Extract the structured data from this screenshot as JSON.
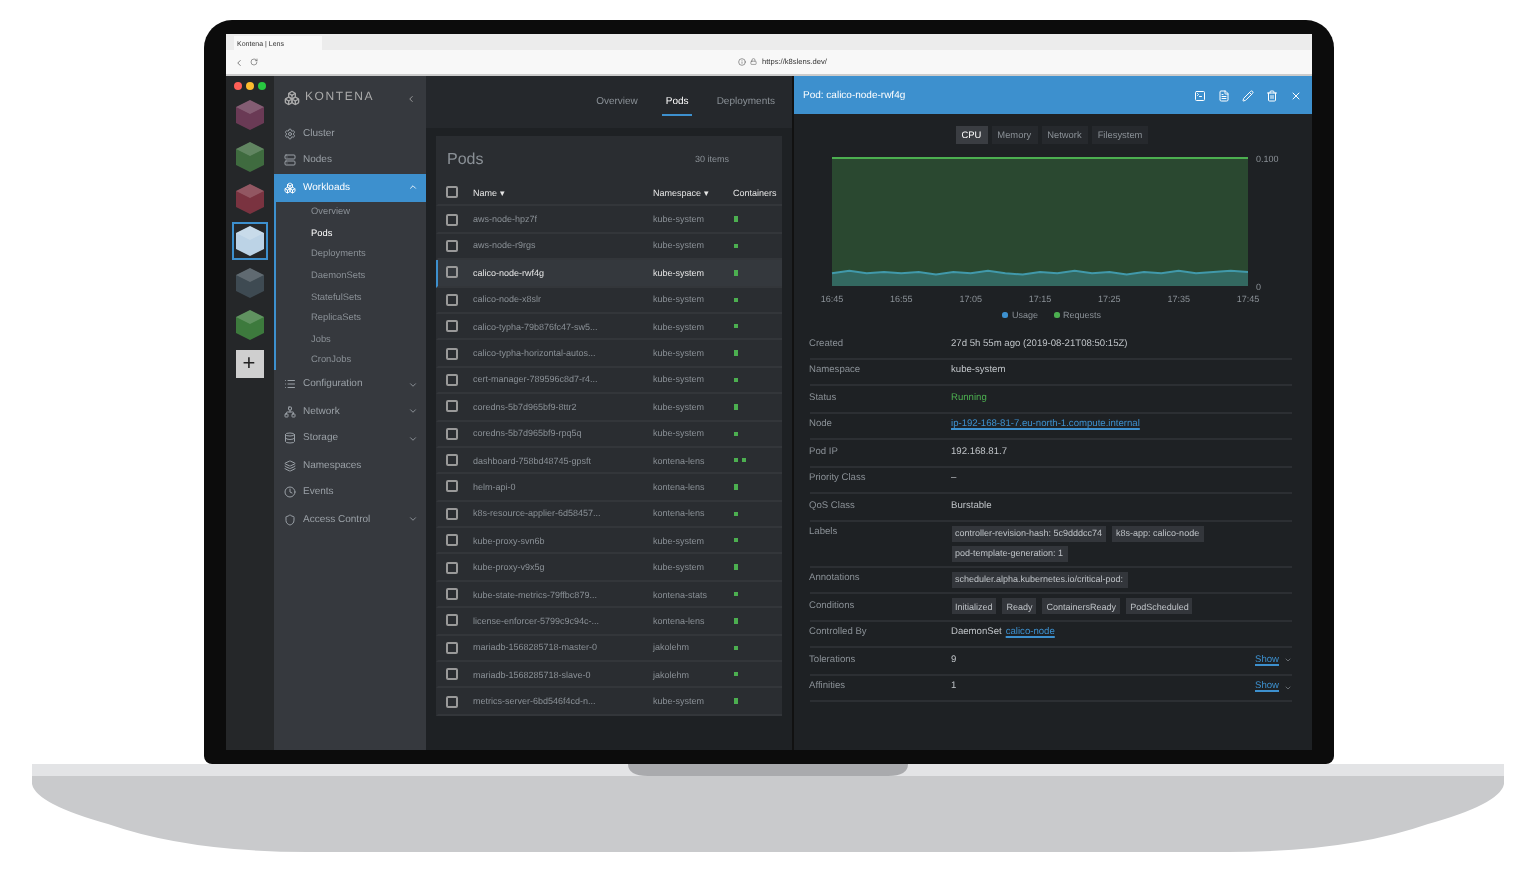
{
  "browser": {
    "tab_title": "Kontena | Lens",
    "address": "https://k8slens.dev/"
  },
  "hotbar": {
    "clusters": [
      {
        "color": "#6a3a55",
        "selected": false
      },
      {
        "color": "#3f6b3f",
        "selected": false
      },
      {
        "color": "#7a3340",
        "selected": false
      },
      {
        "color": "#bcd3e6",
        "selected": true
      },
      {
        "color": "#3e4a52",
        "selected": false
      },
      {
        "color": "#3d7a3d",
        "selected": false
      }
    ],
    "add_label": "+"
  },
  "sidebar": {
    "logo": "KONTENA",
    "items": [
      {
        "label": "Cluster",
        "selected": false
      },
      {
        "label": "Nodes",
        "selected": false
      },
      {
        "label": "Workloads",
        "selected": true,
        "expanded": true,
        "children": [
          {
            "label": "Overview",
            "selected": false
          },
          {
            "label": "Pods",
            "selected": true
          },
          {
            "label": "Deployments",
            "selected": false
          },
          {
            "label": "DaemonSets",
            "selected": false
          },
          {
            "label": "StatefulSets",
            "selected": false
          },
          {
            "label": "ReplicaSets",
            "selected": false
          },
          {
            "label": "Jobs",
            "selected": false
          },
          {
            "label": "CronJobs",
            "selected": false
          }
        ]
      },
      {
        "label": "Configuration",
        "selected": false,
        "expanded": false
      },
      {
        "label": "Network",
        "selected": false,
        "expanded": false
      },
      {
        "label": "Storage",
        "selected": false,
        "expanded": false
      },
      {
        "label": "Namespaces",
        "selected": false
      },
      {
        "label": "Events",
        "selected": false
      },
      {
        "label": "Access Control",
        "selected": false,
        "expanded": false
      }
    ]
  },
  "tabs": [
    {
      "label": "Overview",
      "selected": false
    },
    {
      "label": "Pods",
      "selected": true
    },
    {
      "label": "Deployments",
      "selected": false
    }
  ],
  "pods": {
    "title": "Pods",
    "count": "30 items",
    "all_checked": false,
    "columns": [
      {
        "label": "Name",
        "sort": "▾"
      },
      {
        "label": "Namespace",
        "sort": "▾"
      },
      {
        "label": "Containers"
      }
    ],
    "rows": [
      {
        "name": "aws-node-hpz7f",
        "namespace": "kube-system",
        "containers": [
          {
            "color": "#4caf50"
          }
        ],
        "checked": false,
        "selected": false
      },
      {
        "name": "aws-node-r9rgs",
        "namespace": "kube-system",
        "containers": [
          {
            "color": "#4caf50"
          }
        ],
        "checked": false,
        "selected": false
      },
      {
        "name": "calico-node-rwf4g",
        "namespace": "kube-system",
        "containers": [
          {
            "color": "#4caf50"
          }
        ],
        "checked": false,
        "selected": true
      },
      {
        "name": "calico-node-x8slr",
        "namespace": "kube-system",
        "containers": [
          {
            "color": "#4caf50"
          }
        ],
        "checked": false,
        "selected": false
      },
      {
        "name": "calico-typha-79b876fc47-sw5...",
        "namespace": "kube-system",
        "containers": [
          {
            "color": "#4caf50"
          }
        ],
        "checked": false,
        "selected": false
      },
      {
        "name": "calico-typha-horizontal-autos...",
        "namespace": "kube-system",
        "containers": [
          {
            "color": "#4caf50"
          }
        ],
        "checked": false,
        "selected": false
      },
      {
        "name": "cert-manager-789596c8d7-r4...",
        "namespace": "kube-system",
        "containers": [
          {
            "color": "#4caf50"
          }
        ],
        "checked": false,
        "selected": false
      },
      {
        "name": "coredns-5b7d965bf9-8ttr2",
        "namespace": "kube-system",
        "containers": [
          {
            "color": "#4caf50"
          }
        ],
        "checked": false,
        "selected": false
      },
      {
        "name": "coredns-5b7d965bf9-rpq5q",
        "namespace": "kube-system",
        "containers": [
          {
            "color": "#4caf50"
          }
        ],
        "checked": false,
        "selected": false
      },
      {
        "name": "dashboard-758bd48745-gpsft",
        "namespace": "kontena-lens",
        "containers": [
          {
            "color": "#4caf50"
          },
          {
            "color": "#4caf50"
          }
        ],
        "checked": false,
        "selected": false
      },
      {
        "name": "helm-api-0",
        "namespace": "kontena-lens",
        "containers": [
          {
            "color": "#4caf50"
          }
        ],
        "checked": false,
        "selected": false
      },
      {
        "name": "k8s-resource-applier-6d58457...",
        "namespace": "kontena-lens",
        "containers": [
          {
            "color": "#4caf50"
          }
        ],
        "checked": false,
        "selected": false
      },
      {
        "name": "kube-proxy-svn6b",
        "namespace": "kube-system",
        "containers": [
          {
            "color": "#4caf50"
          }
        ],
        "checked": false,
        "selected": false
      },
      {
        "name": "kube-proxy-v9x5g",
        "namespace": "kube-system",
        "containers": [
          {
            "color": "#4caf50"
          }
        ],
        "checked": false,
        "selected": false
      },
      {
        "name": "kube-state-metrics-79ffbc879...",
        "namespace": "kontena-stats",
        "containers": [
          {
            "color": "#4caf50"
          }
        ],
        "checked": false,
        "selected": false
      },
      {
        "name": "license-enforcer-5799c9c94c-...",
        "namespace": "kontena-lens",
        "containers": [
          {
            "color": "#4caf50"
          }
        ],
        "checked": false,
        "selected": false
      },
      {
        "name": "mariadb-1568285718-master-0",
        "namespace": "jakolehm",
        "containers": [
          {
            "color": "#4caf50"
          }
        ],
        "checked": false,
        "selected": false
      },
      {
        "name": "mariadb-1568285718-slave-0",
        "namespace": "jakolehm",
        "containers": [
          {
            "color": "#4caf50"
          }
        ],
        "checked": false,
        "selected": false
      },
      {
        "name": "metrics-server-6bd546f4cd-n...",
        "namespace": "kube-system",
        "containers": [
          {
            "color": "#4caf50"
          }
        ],
        "checked": false,
        "selected": false
      }
    ]
  },
  "drawer": {
    "title": "Pod: calico-node-rwf4g",
    "chart_tabs": [
      {
        "label": "CPU",
        "selected": true
      },
      {
        "label": "Memory",
        "selected": false
      },
      {
        "label": "Network",
        "selected": false
      },
      {
        "label": "Filesystem",
        "selected": false
      }
    ],
    "chart_data": {
      "type": "area",
      "categories": [
        "16:45",
        null,
        null,
        null,
        "16:55",
        null,
        null,
        null,
        "17:05",
        null,
        null,
        null,
        "17:15",
        null,
        null,
        null,
        "17:25",
        null,
        null,
        null,
        "17:35",
        null,
        null,
        null,
        "17:45"
      ],
      "series": [
        {
          "name": "Usage",
          "color": "#3d90ce",
          "values": [
            0.01,
            0.012,
            0.01,
            0.011,
            0.01,
            0.011,
            0.009,
            0.011,
            0.01,
            0.012,
            0.01,
            0.009,
            0.011,
            0.01,
            0.012,
            0.01,
            0.011,
            0.009,
            0.011,
            0.01,
            0.012,
            0.01,
            0.011,
            0.012,
            0.011
          ]
        },
        {
          "name": "Requests",
          "color": "#4caf50",
          "values": [
            0.1,
            0.1,
            0.1,
            0.1,
            0.1,
            0.1,
            0.1,
            0.1,
            0.1,
            0.1,
            0.1,
            0.1,
            0.1,
            0.1,
            0.1,
            0.1,
            0.1,
            0.1,
            0.1,
            0.1,
            0.1,
            0.1,
            0.1,
            0.1,
            0.1
          ]
        }
      ],
      "ylim": [
        0,
        0.1
      ],
      "yticks": [
        {
          "value": 0,
          "label": "0"
        },
        {
          "value": 0.1,
          "label": "0.100"
        }
      ]
    },
    "details": [
      {
        "label": "Created",
        "kind": "text",
        "value": "27d 5h 55m ago (2019-08-21T08:50:15Z)"
      },
      {
        "label": "Namespace",
        "kind": "text",
        "value": "kube-system"
      },
      {
        "label": "Status",
        "kind": "status",
        "value": "Running"
      },
      {
        "label": "Node",
        "kind": "link",
        "value": "ip-192-168-81-7.eu-north-1.compute.internal"
      },
      {
        "label": "Pod IP",
        "kind": "text",
        "value": "192.168.81.7"
      },
      {
        "label": "Priority Class",
        "kind": "text",
        "value": "–"
      },
      {
        "label": "QoS Class",
        "kind": "text",
        "value": "Burstable"
      },
      {
        "label": "Labels",
        "kind": "chips",
        "items": [
          "controller-revision-hash: 5c9dddcc74",
          "k8s-app: calico-node",
          "pod-template-generation: 1"
        ]
      },
      {
        "label": "Annotations",
        "kind": "chips",
        "items": [
          "scheduler.alpha.kubernetes.io/critical-pod:"
        ]
      },
      {
        "label": "Conditions",
        "kind": "chips",
        "items": [
          "Initialized",
          "Ready",
          "ContainersReady",
          "PodScheduled"
        ]
      },
      {
        "label": "Controlled By",
        "kind": "controller",
        "value": "DaemonSet",
        "link": "calico-node"
      },
      {
        "label": "Tolerations",
        "kind": "expander",
        "value": "9",
        "action": "Show"
      },
      {
        "label": "Affinities",
        "kind": "expander",
        "value": "1",
        "action": "Show"
      }
    ]
  }
}
